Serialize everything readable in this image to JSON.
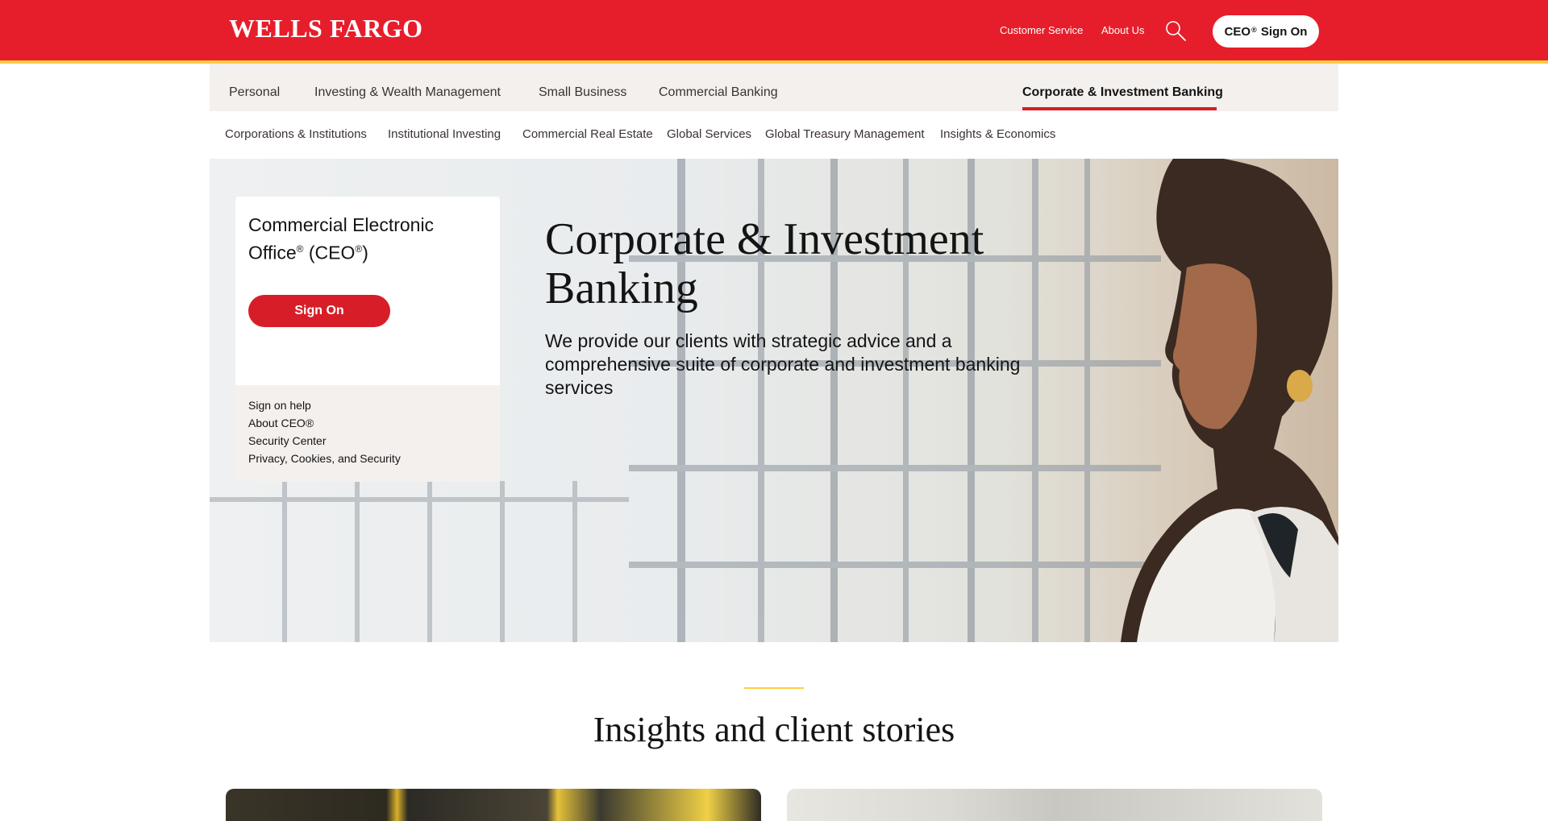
{
  "header": {
    "logo_text": "WELLS FARGO",
    "customer_service": "Customer Service",
    "about_us": "About Us",
    "search_icon": "search-icon",
    "ceo_button": {
      "prefix": "CEO",
      "registered": "®",
      "suffix": "Sign On"
    },
    "colors": {
      "brand_red": "#e61e2b",
      "accent_gold": "#ffcd41"
    }
  },
  "primary_nav": {
    "items": [
      {
        "label": "Personal",
        "active": false
      },
      {
        "label": "Investing & Wealth Management",
        "active": false
      },
      {
        "label": "Small Business",
        "active": false
      },
      {
        "label": "Commercial Banking",
        "active": false
      },
      {
        "label": "Corporate & Investment Banking",
        "active": true
      }
    ]
  },
  "secondary_nav": {
    "items": [
      "Corporations & Institutions",
      "Institutional Investing",
      "Commercial Real Estate",
      "Global Services",
      "Global Treasury Management",
      "Insights & Economics"
    ]
  },
  "hero": {
    "card": {
      "title_line1": "Commercial Electronic",
      "title_line2_a": "Office",
      "title_line2_b": " (CEO",
      "title_line2_c": ")",
      "registered": "®",
      "sign_on_button": "Sign On",
      "links": [
        "Sign on help",
        "About CEO®",
        "Security Center",
        "Privacy, Cookies, and Security"
      ]
    },
    "title_line1": "Corporate & Investment",
    "title_line2": "Banking",
    "subtitle": "We provide our clients with strategic advice and a comprehensive suite of corporate and investment banking services"
  },
  "insights": {
    "title": "Insights and client stories"
  }
}
